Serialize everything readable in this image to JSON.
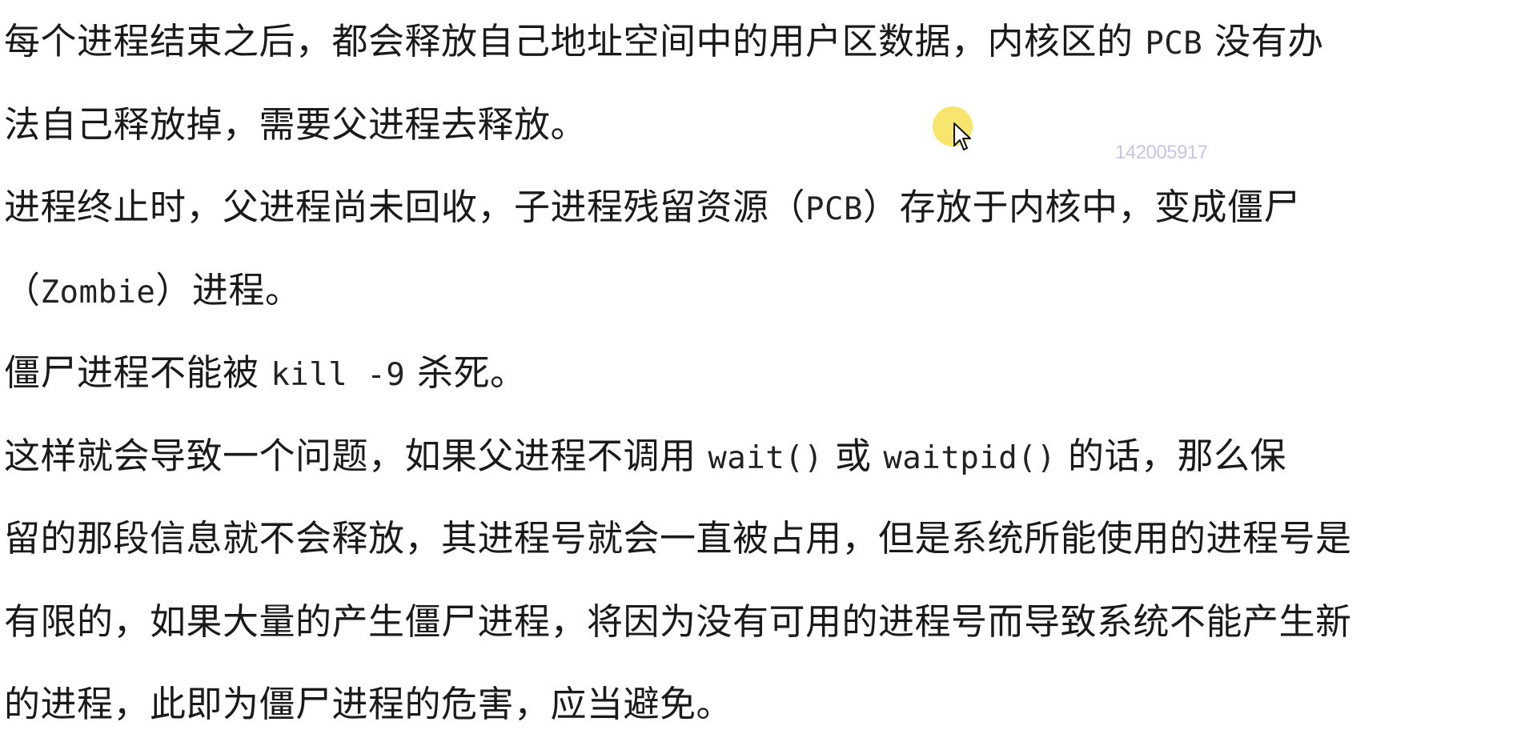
{
  "watermark": "142005917",
  "paragraphs": [
    {
      "lines": [
        [
          {
            "text": "每个进程结束之后，都会释放自己地址空间中的用户区数据，内核区的 "
          },
          {
            "text": "PCB",
            "code": true
          },
          {
            "text": " 没有办"
          }
        ],
        [
          {
            "text": "法自己释放掉，需要父进程去释放。"
          }
        ]
      ]
    },
    {
      "lines": [
        [
          {
            "text": "进程终止时，父进程尚未回收，子进程残留资源（"
          },
          {
            "text": "PCB",
            "code": true
          },
          {
            "text": "）存放于内核中，变成僵尸"
          }
        ],
        [
          {
            "text": "（"
          },
          {
            "text": "Zombie",
            "code": true
          },
          {
            "text": "）进程。"
          }
        ]
      ]
    },
    {
      "lines": [
        [
          {
            "text": "僵尸进程不能被 "
          },
          {
            "text": "kill -9",
            "code": true
          },
          {
            "text": " 杀死。"
          }
        ]
      ]
    },
    {
      "lines": [
        [
          {
            "text": "这样就会导致一个问题，如果父进程不调用 "
          },
          {
            "text": "wait()",
            "code": true
          },
          {
            "text": " 或 "
          },
          {
            "text": "waitpid()",
            "code": true
          },
          {
            "text": " 的话，那么保"
          }
        ],
        [
          {
            "text": "留的那段信息就不会释放，其进程号就会一直被占用，但是系统所能使用的进程号是"
          }
        ],
        [
          {
            "text": "有限的，如果大量的产生僵尸进程，将因为没有可用的进程号而导致系统不能产生新"
          }
        ],
        [
          {
            "text": "的进程，此即为僵尸进程的危害，应当避免。"
          }
        ]
      ]
    }
  ]
}
